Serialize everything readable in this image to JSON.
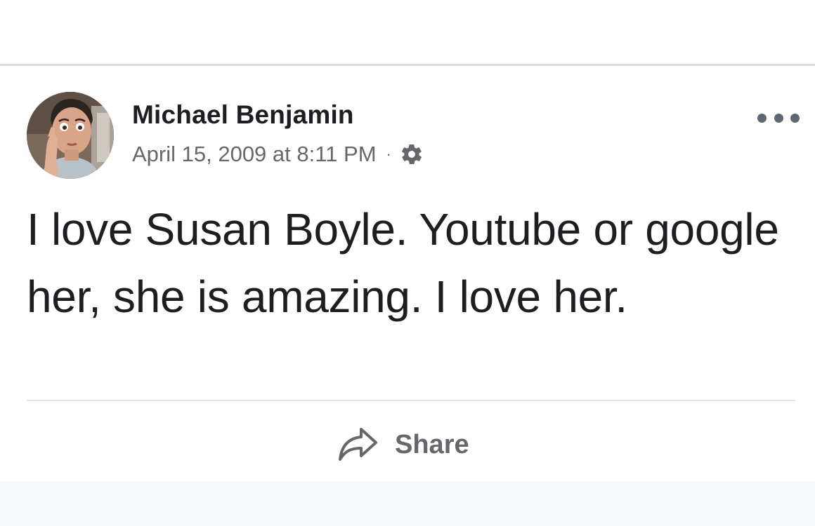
{
  "post": {
    "author": {
      "name": "Michael Benjamin",
      "avatar_icon": "profile-photo"
    },
    "timestamp": "April 15, 2009 at 8:11 PM",
    "separator": "·",
    "privacy_icon": "gear-icon",
    "more_icon": "more-options-icon",
    "text": "I love Susan Boyle. Youtube or google her, she is amazing. I love her.",
    "actions": {
      "share_label": "Share",
      "share_icon": "share-arrow-icon"
    }
  },
  "colors": {
    "text_primary": "#1c1e21",
    "text_secondary": "#65676b",
    "divider": "#dadde1",
    "bottom_background": "#f7f8fa"
  }
}
